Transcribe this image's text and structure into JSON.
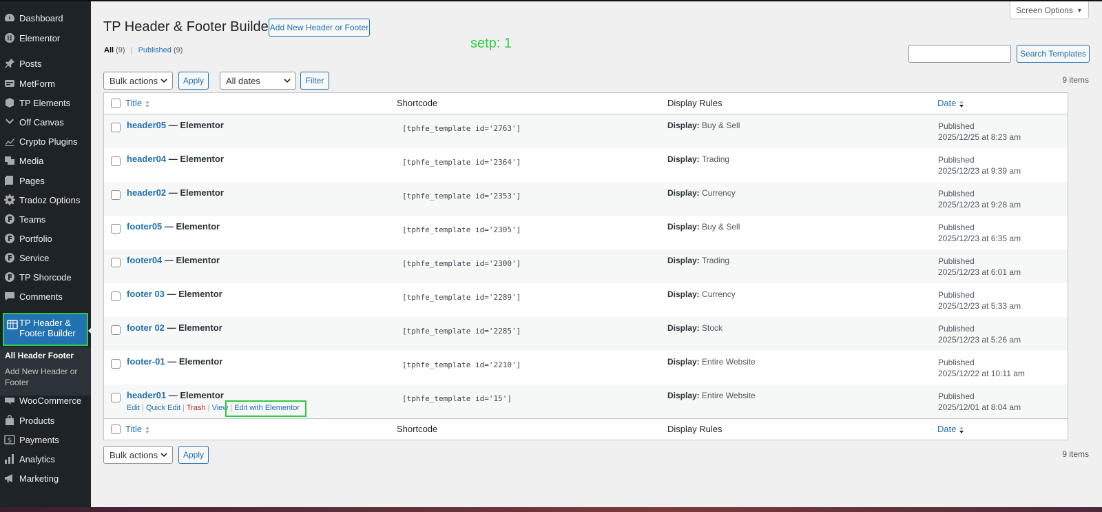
{
  "sidebar": {
    "items": [
      {
        "label": "Dashboard",
        "icon": "dashboard-icon"
      },
      {
        "label": "Elementor",
        "icon": "elementor-icon"
      },
      {
        "label": "Posts",
        "icon": "pin-icon"
      },
      {
        "label": "MetForm",
        "icon": "metform-icon"
      },
      {
        "label": "TP Elements",
        "icon": "tp-elements-icon"
      },
      {
        "label": "Off Canvas",
        "icon": "chevron-down-icon"
      },
      {
        "label": "Crypto Plugins",
        "icon": "chart-icon"
      },
      {
        "label": "Media",
        "icon": "media-icon"
      },
      {
        "label": "Pages",
        "icon": "pages-icon"
      },
      {
        "label": "Tradoz Options",
        "icon": "gear-icon"
      },
      {
        "label": "Teams",
        "icon": "circle-icon"
      },
      {
        "label": "Portfolio",
        "icon": "circle-icon"
      },
      {
        "label": "Service",
        "icon": "circle-icon"
      },
      {
        "label": "TP Shorcode",
        "icon": "circle-icon"
      },
      {
        "label": "Comments",
        "icon": "comment-icon"
      }
    ],
    "current": {
      "label": "TP Header & Footer Builder",
      "icon": "grid-icon"
    },
    "submenu": {
      "all": "All Header Footer",
      "add_new": "Add New Header or Footer"
    },
    "bottom_items": [
      {
        "label": "WooCommerce",
        "icon": "woo-icon"
      },
      {
        "label": "Products",
        "icon": "products-icon"
      },
      {
        "label": "Payments",
        "icon": "dollar-icon"
      },
      {
        "label": "Analytics",
        "icon": "bar-chart-icon"
      },
      {
        "label": "Marketing",
        "icon": "megaphone-icon"
      }
    ]
  },
  "header": {
    "screen_options": "Screen Options",
    "title": "TP Header & Footer Builder",
    "add_new": "Add New Header or Footer",
    "annotation": "setp: 1"
  },
  "views": {
    "all_label": "All",
    "all_count": "(9)",
    "published_label": "Published",
    "published_count": "(9)"
  },
  "search": {
    "button": "Search Templates",
    "value": ""
  },
  "toolbar": {
    "bulk_actions": "Bulk actions",
    "apply": "Apply",
    "all_dates": "All dates",
    "filter": "Filter",
    "items_count": "9 items"
  },
  "table": {
    "columns": {
      "title": "Title",
      "shortcode": "Shortcode",
      "display_rules": "Display Rules",
      "date": "Date"
    },
    "display_prefix": "Display:",
    "rows": [
      {
        "name": "header05",
        "suffix": " — Elementor",
        "shortcode": "[tphfe_template id='2763']",
        "display": "Buy & Sell",
        "status": "Published",
        "date": "2025/12/25 at 8:23 am"
      },
      {
        "name": "header04",
        "suffix": " — Elementor",
        "shortcode": "[tphfe_template id='2364']",
        "display": "Trading",
        "status": "Published",
        "date": "2025/12/23 at 9:39 am"
      },
      {
        "name": "header02",
        "suffix": " — Elementor",
        "shortcode": "[tphfe_template id='2353']",
        "display": "Currency",
        "status": "Published",
        "date": "2025/12/23 at 9:28 am"
      },
      {
        "name": "footer05",
        "suffix": " — Elementor",
        "shortcode": "[tphfe_template id='2305']",
        "display": "Buy & Sell",
        "status": "Published",
        "date": "2025/12/23 at 6:35 am"
      },
      {
        "name": "footer04",
        "suffix": " — Elementor",
        "shortcode": "[tphfe_template id='2300']",
        "display": "Trading",
        "status": "Published",
        "date": "2025/12/23 at 6:01 am"
      },
      {
        "name": "footer 03",
        "suffix": " — Elementor",
        "shortcode": "[tphfe_template id='2289']",
        "display": "Currency",
        "status": "Published",
        "date": "2025/12/23 at 5:33 am"
      },
      {
        "name": "footer 02",
        "suffix": " — Elementor",
        "shortcode": "[tphfe_template id='2285']",
        "display": "Stock",
        "status": "Published",
        "date": "2025/12/23 at 5:26 am"
      },
      {
        "name": "footer-01",
        "suffix": " — Elementor",
        "shortcode": "[tphfe_template id='2210']",
        "display": "Entire Website",
        "status": "Published",
        "date": "2025/12/22 at 10:11 am"
      },
      {
        "name": "header01",
        "suffix": " — Elementor",
        "shortcode": "[tphfe_template id='15']",
        "display": "Entire Website",
        "status": "Published",
        "date": "2025/12/01 at 8:04 am"
      }
    ],
    "row_actions": {
      "edit": "Edit",
      "quick_edit": "Quick Edit",
      "trash": "Trash",
      "view": "View",
      "edit_with_elementor": "Edit with Elementor",
      "separator": "|"
    }
  },
  "colors": {
    "accent": "#2271b1",
    "annotation": "#2ecc40",
    "sidebar": "#1d2327"
  }
}
